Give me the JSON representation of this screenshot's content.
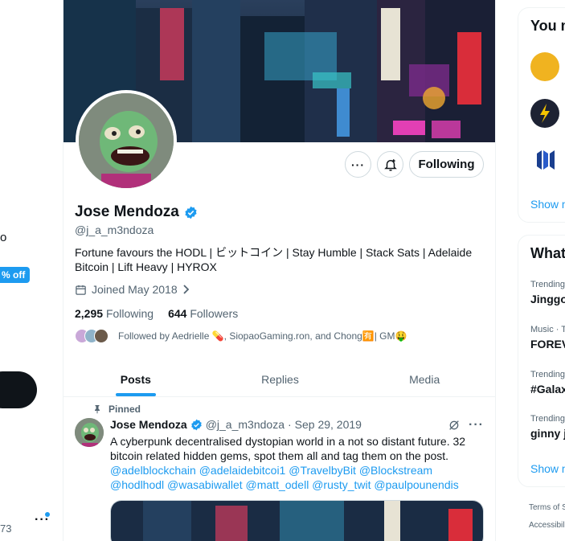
{
  "left_nav": {
    "partial_text": "o",
    "badge": "% off",
    "count": "73",
    "more_icon": "ellipsis-icon"
  },
  "profile": {
    "name": "Jose Mendoza",
    "handle": "@j_a_m3ndoza",
    "bio": "Fortune favours the HODL | ビットコイン | Stay Humble | Stack Sats | Adelaide Bitcoin | Lift Heavy | HYROX",
    "joined": "Joined May 2018",
    "following_count": "2,295",
    "following_label": "Following",
    "followers_count": "644",
    "followers_label": "Followers",
    "followed_by": "Followed by Aedrielle 💊, SiopaoGaming.ron, and Chong🈶| GM🤑",
    "follow_button": "Following",
    "accent": "#1d9bf0"
  },
  "tabs": [
    {
      "label": "Posts",
      "active": true
    },
    {
      "label": "Replies",
      "active": false
    },
    {
      "label": "Media",
      "active": false
    }
  ],
  "pinned_tweet": {
    "pinned_label": "Pinned",
    "name": "Jose Mendoza",
    "handle": "@j_a_m3ndoza",
    "sep": "·",
    "date": "Sep 29, 2019",
    "text": "A cyberpunk decentralised dystopian world in a not so distant future. 32 bitcoin related hidden gems, spot them all and tag them on the post.",
    "mentions_line1": "@adelblockchain @adelaidebitcoi1 @TravelbyBit @Blockstream",
    "mentions_line2": "@hodlhodl @wasabiwallet @matt_odell @rusty_twit @paulpounendis"
  },
  "right": {
    "card1_title": "You m",
    "show_more1": "Show m",
    "card2_title": "What",
    "trends": [
      {
        "meta": "Trending",
        "name": "Jinggoy"
      },
      {
        "meta": "Music · T",
        "name": "FOREV"
      },
      {
        "meta": "Trending",
        "name": "#Galax"
      },
      {
        "meta": "Trending",
        "name": "ginny ja"
      }
    ],
    "show_more2": "Show m",
    "footer1": "Terms of S",
    "footer2": "Accessibil"
  }
}
